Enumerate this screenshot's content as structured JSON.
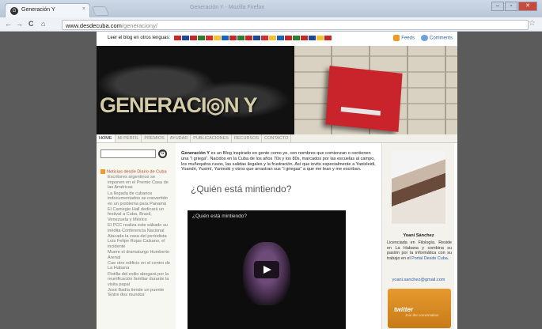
{
  "browser": {
    "tab_title": "Generación Y",
    "tab_favicon": "G",
    "tab_close": "×",
    "window_title": "Generación Y - Mozilla Firefox",
    "window_buttons": [
      "–",
      "▫",
      "✕"
    ],
    "nav_buttons": [
      "←",
      "→",
      "C",
      "⌂"
    ],
    "url_host": "www.desdecuba.com",
    "url_path": "/generaciony/",
    "star": "☆"
  },
  "langbar": {
    "prompt": "Leer el blog en otros lenguas:",
    "flag_colors": [
      "#c62828",
      "#1a4aa0",
      "#c62828",
      "#2e7d32",
      "#d32f2f",
      "#fbc02d",
      "#1565c0",
      "#c62828",
      "#2e7d32",
      "#c62828",
      "#1a4aa0",
      "#d32f2f",
      "#fbc02d",
      "#1565c0",
      "#c62828",
      "#2e7d32",
      "#c62828",
      "#1a4aa0",
      "#fbc02d",
      "#c62828"
    ],
    "feeds_label": "Feeds",
    "comments_label": "Comments"
  },
  "banner": {
    "logo_text": "GENERACI◎N Y"
  },
  "nav": {
    "items": [
      "HOME",
      "MI PERFIL",
      "PREMIOS",
      "AYUDAR",
      "PUBLICACIONES",
      "RECURSOS",
      "CONTACTO"
    ]
  },
  "sidebar": {
    "search_button": "G",
    "feed_heading": "Noticias desde Diario de Cuba",
    "news": [
      "Escritores argentinos se imponen en el Premio Casa de las Américas",
      "La llegada de cubanos indocumentados se convertido en un problema para Panamá",
      "El Carnegie Hall dedicará un festival a Cuba, Brasil, Venezuela y México",
      "El PCC realiza este sábado su inédita Conferencia Nacional",
      "Atacada la casa del periodista Luis Felipe Rojas Calzano, el incidente",
      "Muere el dramaturgo Humberto Arenal",
      "Cae otro edificio en el centro de La Habana",
      "Flotilla del exilio abogará por la reunificación familiar durante la visita papal",
      "José Badía tiende un puente 'Entre dos mundos'"
    ]
  },
  "main": {
    "intro_bold": "Generación Y",
    "intro_text": " es un Blog inspirado en gente como yo, con nombres que comienzan o contienen una \"i griega\". Nacidos en la Cuba de los años 70s y los 80s, marcados por las escuelas al campo, los muñequitos rusos, las salidas ilegales y la frustración. Así que invito especialmente a Yanisleidi, Yoandri, Yusimí, Yunieski y otros que arrastran sus \"i griegas\" a que me lean y me escriban.",
    "post_title": "¿Quién está mintiendo?",
    "video_title": "¿Quién está mintiendo?"
  },
  "right": {
    "name": "Yoani Sánchez",
    "bio": "Licenciada en Filología. Reside en La Habana y combina su pasión por la informática con su trabajo en el ",
    "bio_link": "Portal Desde Cuba.",
    "email": "yoani.sanchez@gmail.com",
    "twitter_logo": "twitter",
    "twitter_sub": "Join the conversation"
  }
}
